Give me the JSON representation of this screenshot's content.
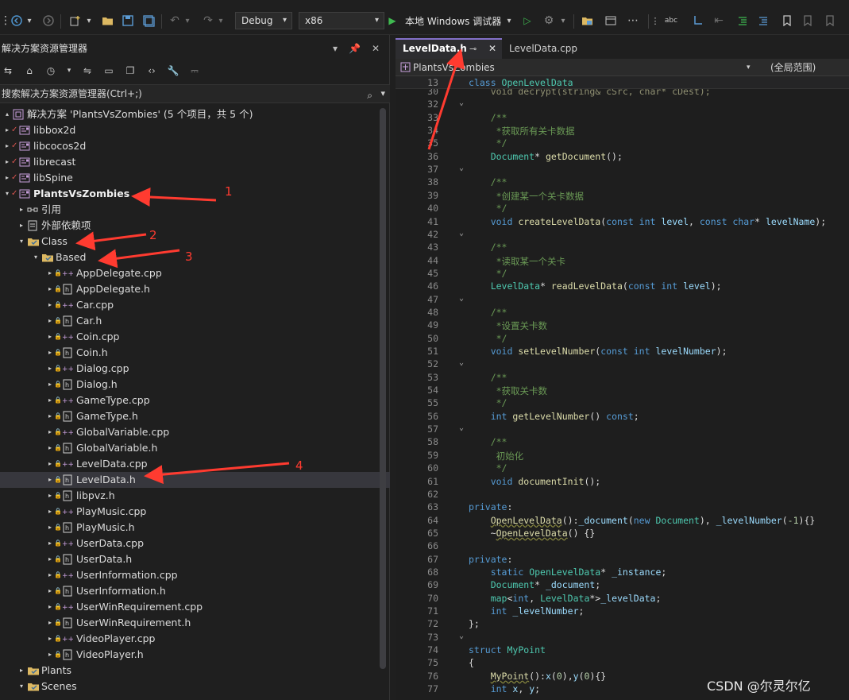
{
  "toolbar": {
    "config": "Debug",
    "platform": "x86",
    "run_label": "本地 Windows 调试器"
  },
  "solution_explorer": {
    "title": "解决方案资源管理器",
    "search_placeholder": "搜索解决方案资源管理器(Ctrl+;)",
    "items": [
      {
        "label": "解决方案 'PlantsVsZombies' (5 个项目，共 5 个)",
        "type": "solution"
      },
      {
        "label": "libbox2d",
        "type": "project"
      },
      {
        "label": "libcocos2d",
        "type": "project"
      },
      {
        "label": "librecast",
        "type": "project"
      },
      {
        "label": "libSpine",
        "type": "project"
      },
      {
        "label": "PlantsVsZombies",
        "type": "project"
      },
      {
        "label": "引用",
        "type": "refs"
      },
      {
        "label": "外部依赖项",
        "type": "deps"
      },
      {
        "label": "Class",
        "type": "filter"
      },
      {
        "label": "Based",
        "type": "filter"
      },
      {
        "label": "AppDelegate.cpp",
        "type": "cpp"
      },
      {
        "label": "AppDelegate.h",
        "type": "h"
      },
      {
        "label": "Car.cpp",
        "type": "cpp"
      },
      {
        "label": "Car.h",
        "type": "h"
      },
      {
        "label": "Coin.cpp",
        "type": "cpp"
      },
      {
        "label": "Coin.h",
        "type": "h"
      },
      {
        "label": "Dialog.cpp",
        "type": "cpp"
      },
      {
        "label": "Dialog.h",
        "type": "h"
      },
      {
        "label": "GameType.cpp",
        "type": "cpp"
      },
      {
        "label": "GameType.h",
        "type": "h"
      },
      {
        "label": "GlobalVariable.cpp",
        "type": "cpp"
      },
      {
        "label": "GlobalVariable.h",
        "type": "h"
      },
      {
        "label": "LevelData.cpp",
        "type": "cpp"
      },
      {
        "label": "LevelData.h",
        "type": "h"
      },
      {
        "label": "libpvz.h",
        "type": "h"
      },
      {
        "label": "PlayMusic.cpp",
        "type": "cpp"
      },
      {
        "label": "PlayMusic.h",
        "type": "h"
      },
      {
        "label": "UserData.cpp",
        "type": "cpp"
      },
      {
        "label": "UserData.h",
        "type": "h"
      },
      {
        "label": "UserInformation.cpp",
        "type": "cpp"
      },
      {
        "label": "UserInformation.h",
        "type": "h"
      },
      {
        "label": "UserWinRequirement.cpp",
        "type": "cpp"
      },
      {
        "label": "UserWinRequirement.h",
        "type": "h"
      },
      {
        "label": "VideoPlayer.cpp",
        "type": "cpp"
      },
      {
        "label": "VideoPlayer.h",
        "type": "h"
      },
      {
        "label": "Plants",
        "type": "filter"
      },
      {
        "label": "Scenes",
        "type": "filter"
      }
    ]
  },
  "editor": {
    "tabs": [
      {
        "label": "LevelData.h",
        "active": true
      },
      {
        "label": "LevelData.cpp",
        "active": false
      }
    ],
    "nav_left": "PlantsVsZombies",
    "nav_right": "(全局范围)",
    "sticky_line_number": "13",
    "sticky_line": "class OpenLevelData",
    "line_numbers": [
      "30",
      "32",
      "33",
      "34",
      "35",
      "36",
      "37",
      "38",
      "39",
      "40",
      "41",
      "42",
      "43",
      "44",
      "45",
      "46",
      "47",
      "48",
      "49",
      "50",
      "51",
      "52",
      "53",
      "54",
      "55",
      "56",
      "57",
      "58",
      "59",
      "60",
      "61",
      "62",
      "63",
      "64",
      "65",
      "66",
      "67",
      "68",
      "69",
      "70",
      "71",
      "72",
      "73",
      "74",
      "75",
      "76",
      "77"
    ]
  },
  "annotations": [
    "1",
    "2",
    "3",
    "4"
  ],
  "watermark": "CSDN @尔灵尔亿"
}
